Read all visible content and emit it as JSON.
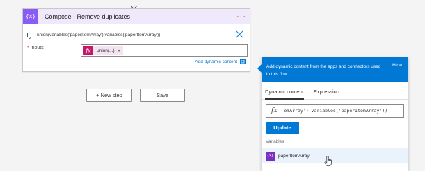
{
  "action_card": {
    "icon_label": "{x}",
    "title": "Compose - Remove duplicates",
    "menu_label": "···",
    "expression": "union(variables('paperItemArray'),variables('paperItemArray'))",
    "inputs_required_mark": "*",
    "inputs_label": "Inputs",
    "token_icon": "fx",
    "token_label": "union(...)",
    "token_remove": "×",
    "add_dynamic_content": "Add dynamic content"
  },
  "buttons": {
    "new_step": "+ New step",
    "save": "Save"
  },
  "dynamic_panel": {
    "header_text": "Add dynamic content from the apps and connectors used in this flow.",
    "hide_label": "Hide",
    "tabs": [
      {
        "label": "Dynamic content",
        "active": true
      },
      {
        "label": "Expression",
        "active": false
      }
    ],
    "fx_glyph": "fx",
    "expression_value": "emArray'),variables('paperItemArray'))",
    "update_label": "Update",
    "section_label": "Variables",
    "variable_icon": "{x}",
    "variable_item": "paperItemArray"
  },
  "colors": {
    "accent": "#0078d4",
    "compose_icon": "#8a5cf6",
    "compose_header_bg": "#efe9fb",
    "expression_token": "#c3186a",
    "variable_icon": "#7a2fbf"
  }
}
